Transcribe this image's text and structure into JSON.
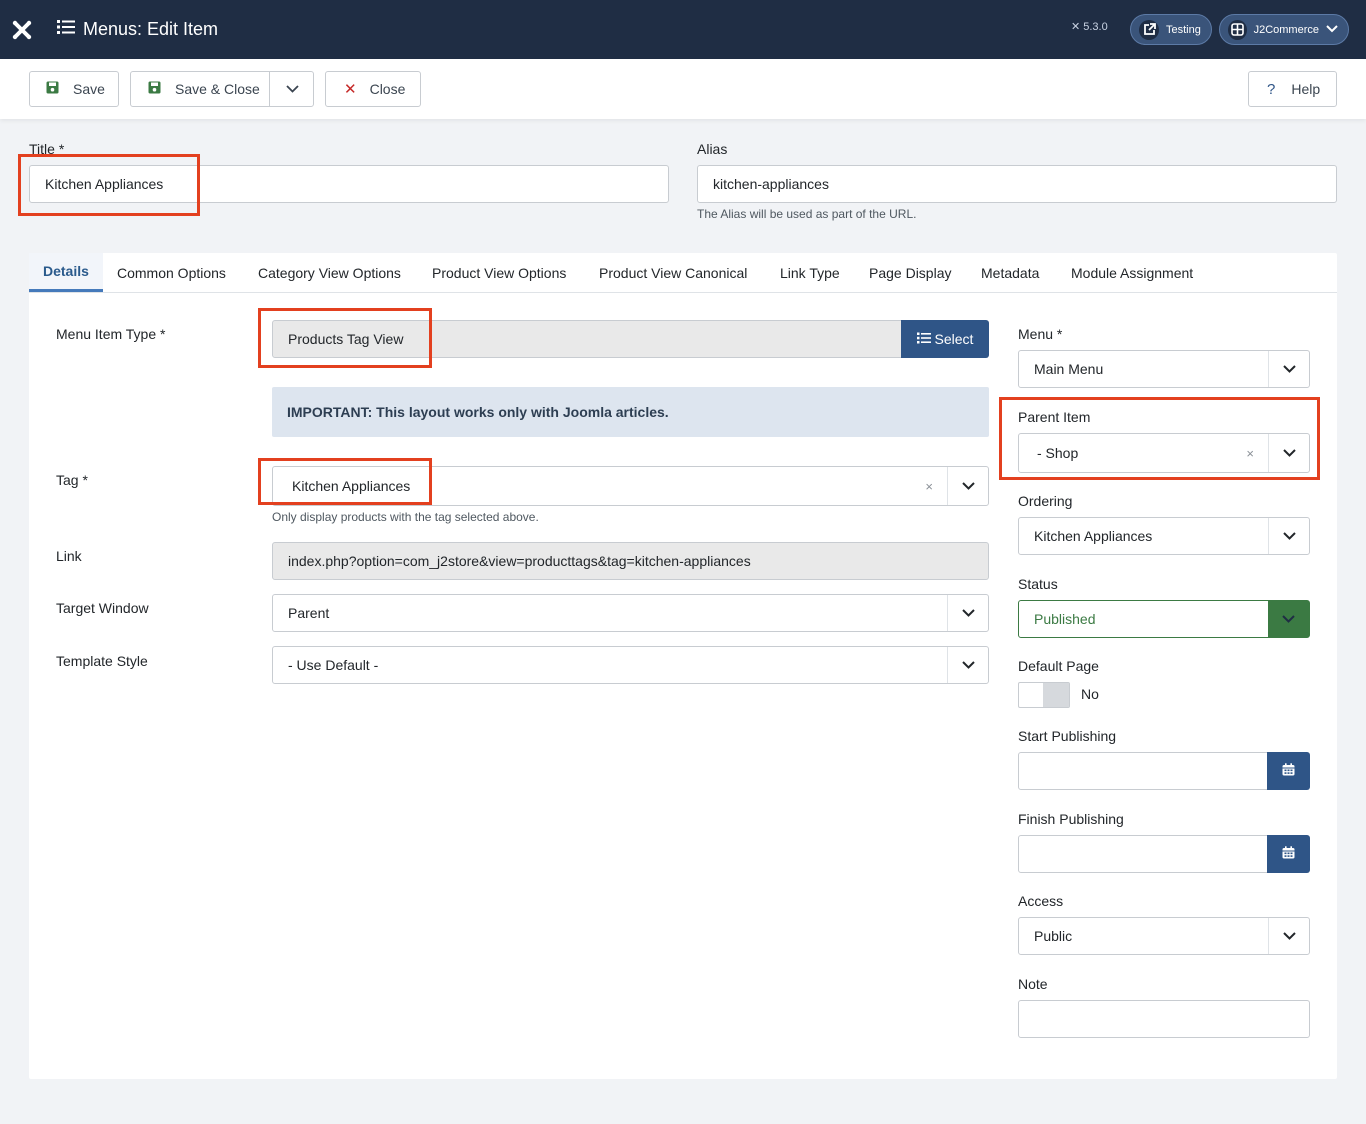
{
  "header": {
    "title": "Menus: Edit Item",
    "version": "5.3.0",
    "testing_label": "Testing",
    "site_label": "J2Commerce"
  },
  "toolbar": {
    "save_label": "Save",
    "save_close_label": "Save & Close",
    "close_label": "Close",
    "help_label": "Help"
  },
  "form": {
    "title_label": "Title *",
    "title_value": "Kitchen Appliances",
    "alias_label": "Alias",
    "alias_value": "kitchen-appliances",
    "alias_hint": "The Alias will be used as part of the URL."
  },
  "tabs": [
    {
      "label": "Details"
    },
    {
      "label": "Common Options"
    },
    {
      "label": "Category View Options"
    },
    {
      "label": "Product View Options"
    },
    {
      "label": "Product View Canonical"
    },
    {
      "label": "Link Type"
    },
    {
      "label": "Page Display"
    },
    {
      "label": "Metadata"
    },
    {
      "label": "Module Assignment"
    }
  ],
  "details": {
    "menu_item_type_label": "Menu Item Type *",
    "menu_item_type_value": "Products Tag View",
    "select_label": "Select",
    "notice": "IMPORTANT: This layout works only with Joomla articles.",
    "tag_label": "Tag *",
    "tag_value": "Kitchen Appliances",
    "tag_clear": "×",
    "tag_hint": "Only display products with the tag selected above.",
    "link_label": "Link",
    "link_value": "index.php?option=com_j2store&view=producttags&tag=kitchen-appliances",
    "target_label": "Target Window",
    "target_value": "Parent",
    "template_label": "Template Style",
    "template_value": "- Use Default -"
  },
  "sidebar": {
    "menu_label": "Menu *",
    "menu_value": "Main Menu",
    "parent_label": "Parent Item",
    "parent_value": "- Shop",
    "parent_clear": "×",
    "ordering_label": "Ordering",
    "ordering_value": "Kitchen Appliances",
    "status_label": "Status",
    "status_value": "Published",
    "default_label": "Default Page",
    "default_value": "No",
    "start_label": "Start Publishing",
    "start_value": "",
    "finish_label": "Finish Publishing",
    "finish_value": "",
    "access_label": "Access",
    "access_value": "Public",
    "note_label": "Note",
    "note_value": ""
  },
  "colors": {
    "header_bg": "#1f2d44",
    "primary": "#2f5587",
    "highlight": "#e3401f",
    "status_green": "#3b7a43"
  }
}
